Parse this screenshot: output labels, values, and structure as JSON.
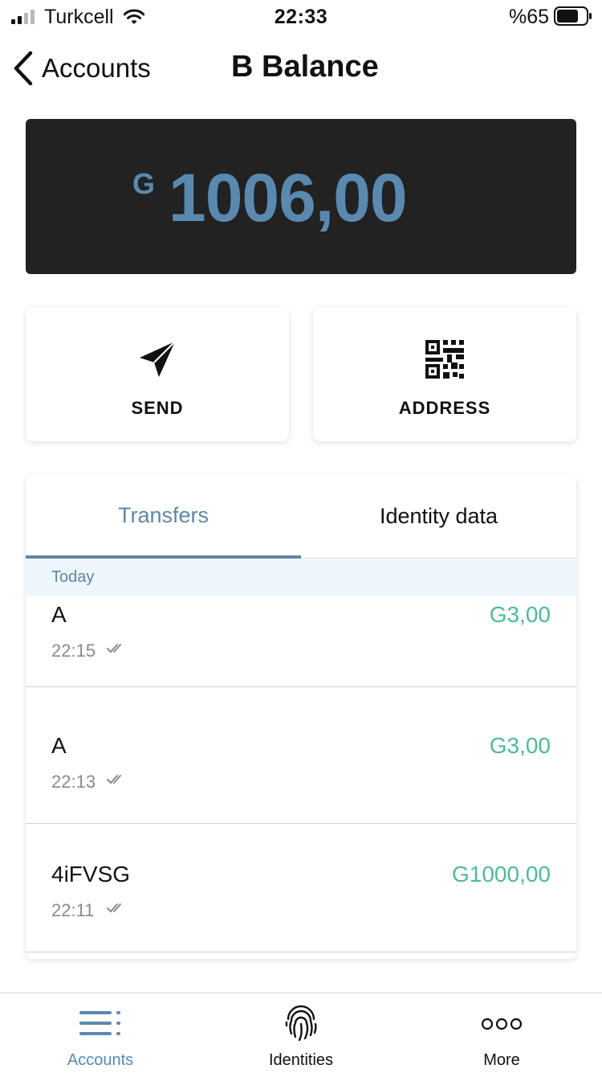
{
  "status_bar": {
    "carrier": "Turkcell",
    "time": "22:33",
    "battery": "%65"
  },
  "nav": {
    "back_label": "Accounts",
    "title": "B Balance"
  },
  "balance": {
    "currency_symbol": "G",
    "amount": "1006,00",
    "color": "#5a89b0"
  },
  "actions": {
    "send_label": "SEND",
    "address_label": "ADDRESS"
  },
  "tabs": {
    "transfers": "Transfers",
    "identity_data": "Identity data",
    "active": "Transfers"
  },
  "transfers": {
    "section": "Today",
    "rows": [
      {
        "name": "A",
        "time": "22:15",
        "amount": "G3,00"
      },
      {
        "name": "A",
        "time": "22:13",
        "amount": "G3,00"
      },
      {
        "name": "4iFVSG",
        "time": "22:11",
        "amount": "G1000,00"
      }
    ],
    "amount_color": "#4fba95"
  },
  "tabbar": {
    "items": [
      {
        "label": "Accounts",
        "icon": "list-icon",
        "active": true
      },
      {
        "label": "Identities",
        "icon": "fingerprint-icon",
        "active": false
      },
      {
        "label": "More",
        "icon": "more-dots-icon",
        "active": false
      }
    ],
    "accent": "#5a89b0"
  }
}
